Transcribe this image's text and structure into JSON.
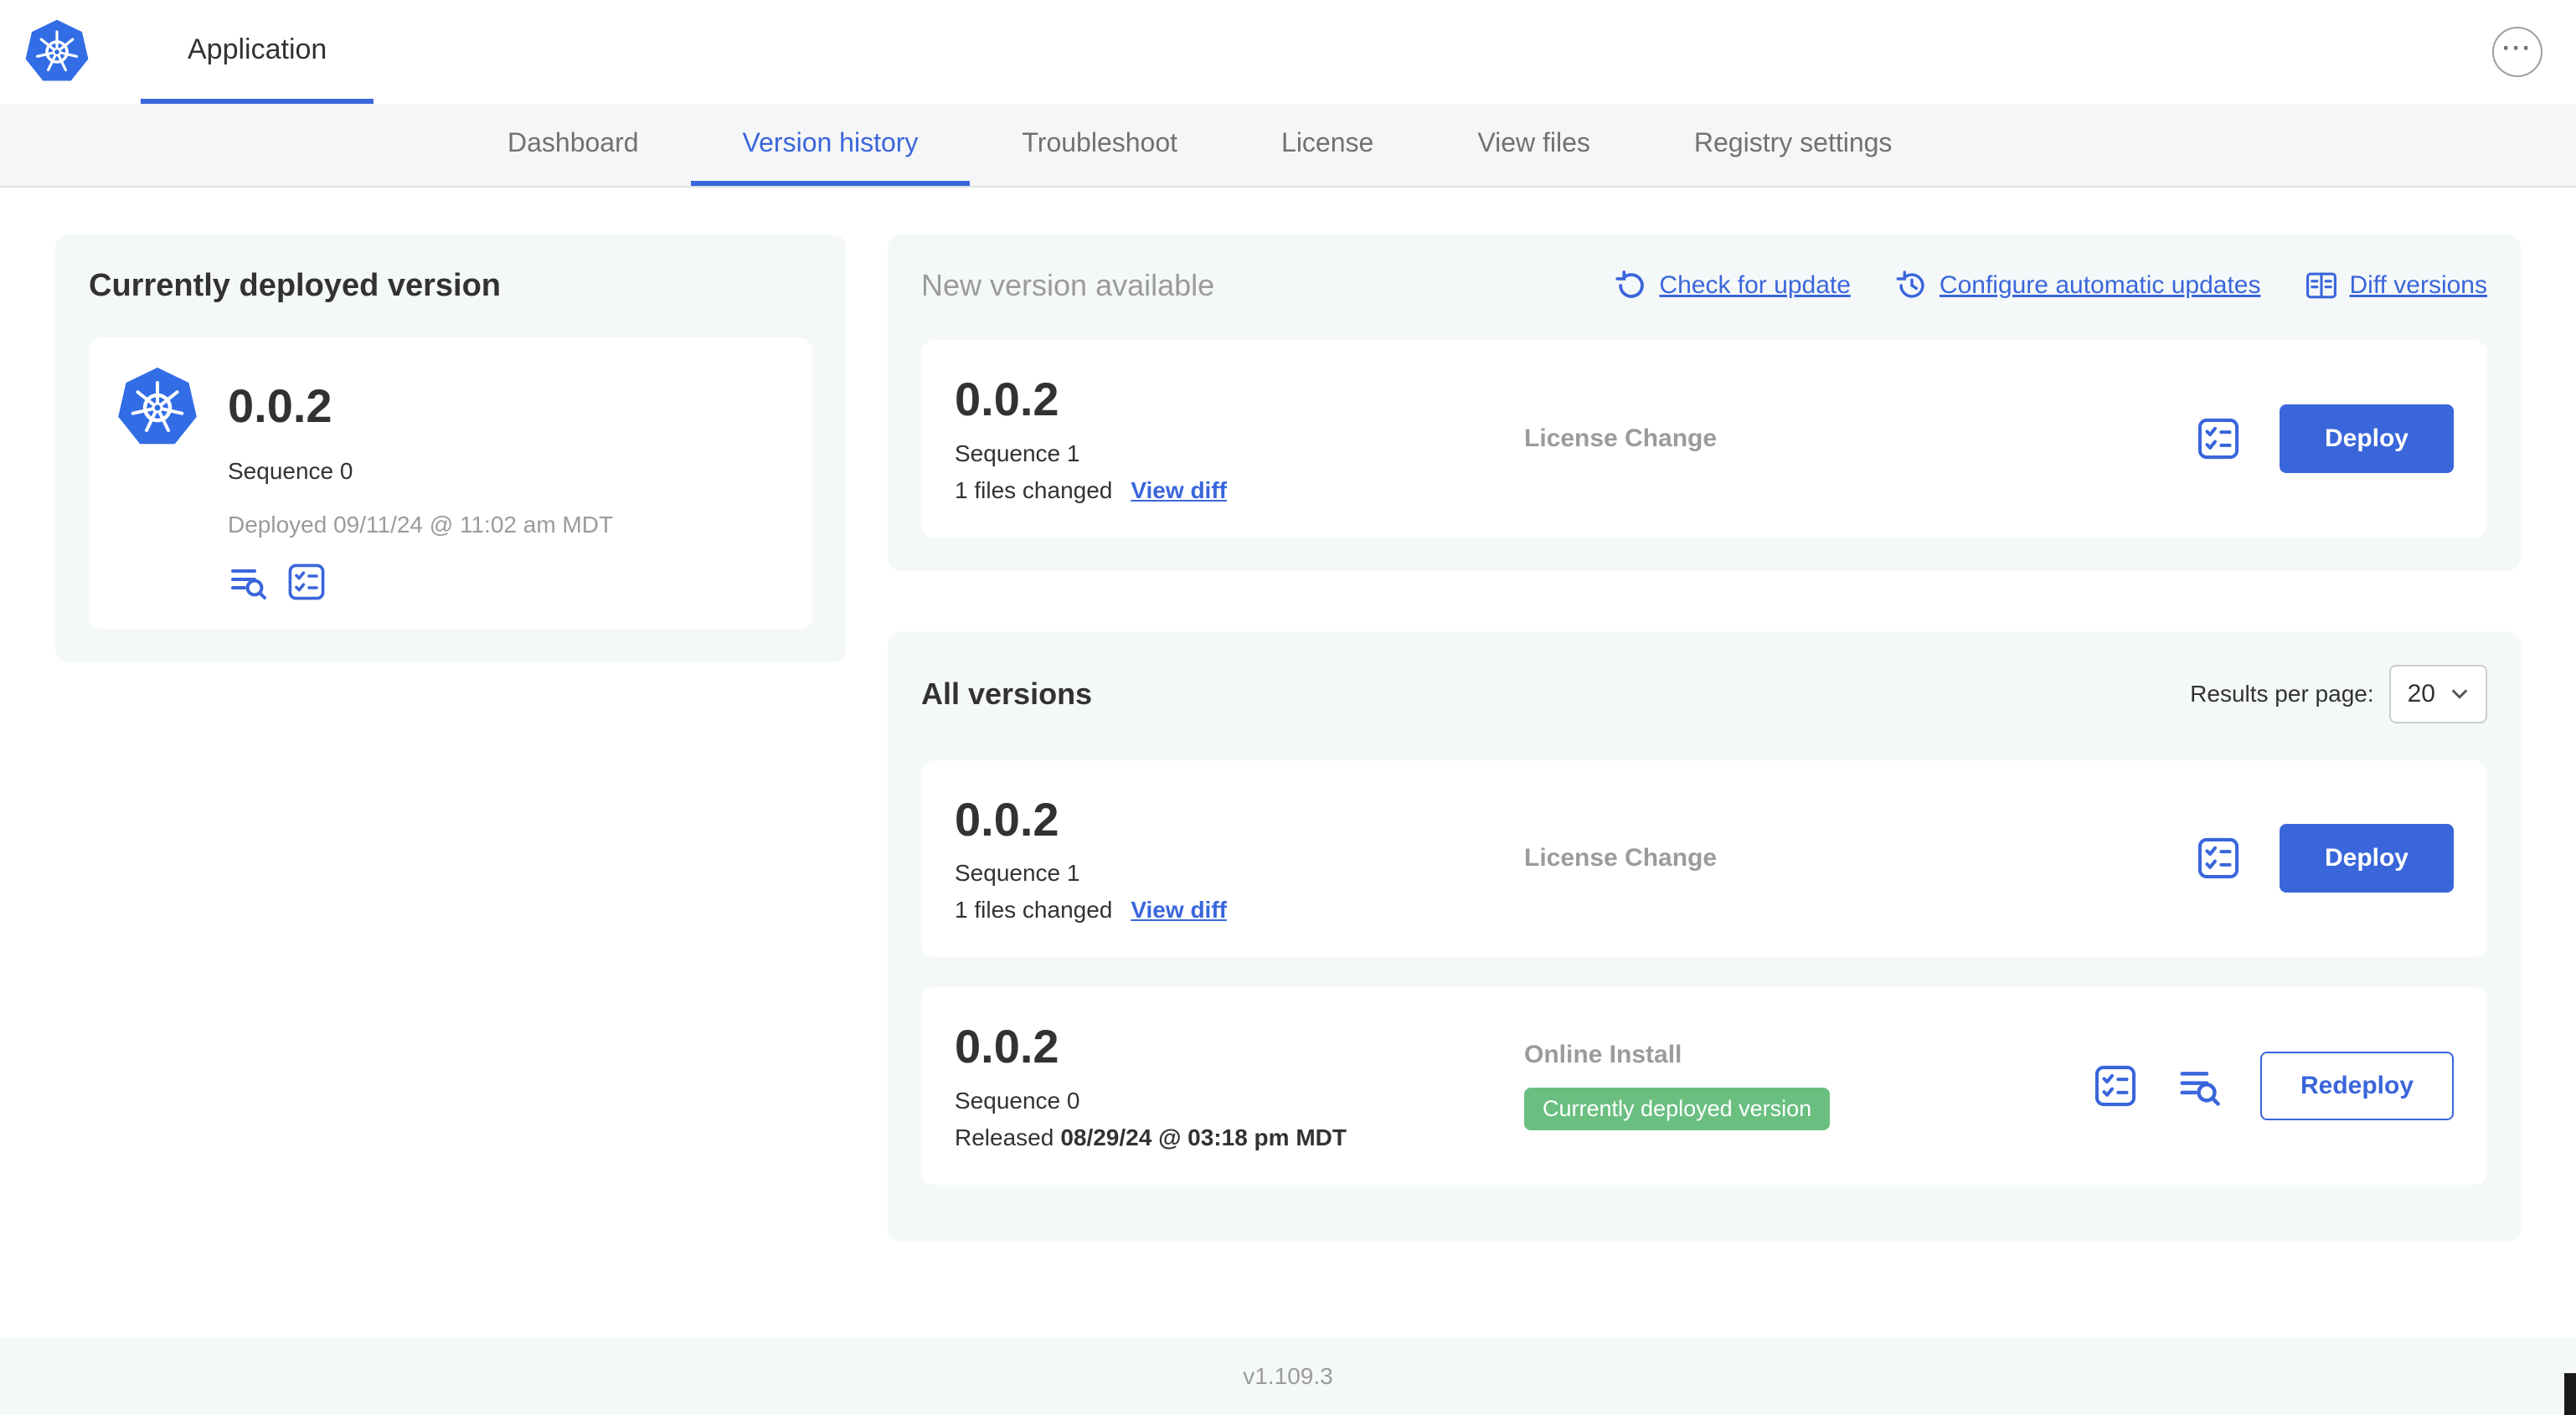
{
  "header": {
    "app_tab": "Application",
    "more_label": "···"
  },
  "nav": {
    "tabs": [
      {
        "label": "Dashboard",
        "active": false
      },
      {
        "label": "Version history",
        "active": true
      },
      {
        "label": "Troubleshoot",
        "active": false
      },
      {
        "label": "License",
        "active": false
      },
      {
        "label": "View files",
        "active": false
      },
      {
        "label": "Registry settings",
        "active": false
      }
    ]
  },
  "current": {
    "title": "Currently deployed version",
    "version": "0.0.2",
    "sequence": "Sequence 0",
    "deployed": "Deployed 09/11/24 @ 11:02 am MDT"
  },
  "new_version": {
    "title": "New version available",
    "check_for_update": "Check for update",
    "configure_updates": "Configure automatic updates",
    "diff_versions": "Diff versions",
    "version": "0.0.2",
    "sequence": "Sequence 1",
    "files_changed": "1 files changed",
    "view_diff": "View diff",
    "change_type": "License Change",
    "deploy": "Deploy"
  },
  "all_versions": {
    "title": "All versions",
    "results_label": "Results per page:",
    "results_value": "20",
    "rows": [
      {
        "version": "0.0.2",
        "sequence": "Sequence 1",
        "files_changed": "1 files changed",
        "view_diff": "View diff",
        "change_type": "License Change",
        "action": "Deploy"
      },
      {
        "version": "0.0.2",
        "sequence": "Sequence 0",
        "released_prefix": "Released",
        "released_date": "08/29/24 @ 03:18 pm MDT",
        "change_type": "Online Install",
        "badge": "Currently deployed version",
        "action": "Redeploy"
      }
    ]
  },
  "footer": {
    "app_version": "v1.109.3"
  },
  "colors": {
    "accent_blue": "#3a66db",
    "kubernetes_blue": "#326de6",
    "badge_green": "#6abf80",
    "muted_gray": "#9b9b9b",
    "panel_gray": "#f5f8f9"
  }
}
